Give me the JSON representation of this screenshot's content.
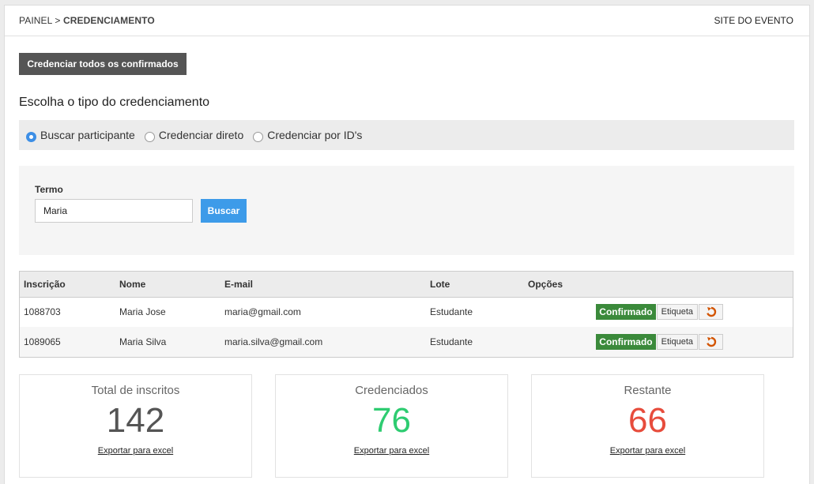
{
  "header": {
    "breadcrumb_root": "PAINEL",
    "breadcrumb_sep": ">",
    "breadcrumb_current": "CREDENCIAMENTO",
    "site_link": "SITE DO EVENTO"
  },
  "actions": {
    "credential_all_label": "Credenciar todos os confirmados"
  },
  "type_section": {
    "title": "Escolha o tipo do credenciamento",
    "options": [
      {
        "label": "Buscar participante",
        "checked": true
      },
      {
        "label": "Credenciar direto",
        "checked": false
      },
      {
        "label": "Credenciar por ID's",
        "checked": false
      }
    ]
  },
  "search": {
    "label": "Termo",
    "value": "Maria",
    "button_label": "Buscar"
  },
  "table": {
    "columns": [
      "Inscrição",
      "Nome",
      "E-mail",
      "Lote",
      "Opções"
    ],
    "rows": [
      {
        "id": "1088703",
        "name": "Maria Jose",
        "email": "maria@gmail.com",
        "lot": "Estudante",
        "status": "Confirmado",
        "label_btn": "Etiqueta"
      },
      {
        "id": "1089065",
        "name": "Maria Silva",
        "email": "maria.silva@gmail.com",
        "lot": "Estudante",
        "status": "Confirmado",
        "label_btn": "Etiqueta"
      }
    ]
  },
  "stats": [
    {
      "title": "Total de inscritos",
      "value": "142",
      "color": "#555555",
      "link": "Exportar para excel"
    },
    {
      "title": "Credenciados",
      "value": "76",
      "color": "#2ecc71",
      "link": "Exportar para excel"
    },
    {
      "title": "Restante",
      "value": "66",
      "color": "#e74c3c",
      "link": "Exportar para excel"
    }
  ],
  "colors": {
    "confirmed": "#3b8a3b",
    "primary": "#3d9be9",
    "undo_icon": "#d35400"
  }
}
